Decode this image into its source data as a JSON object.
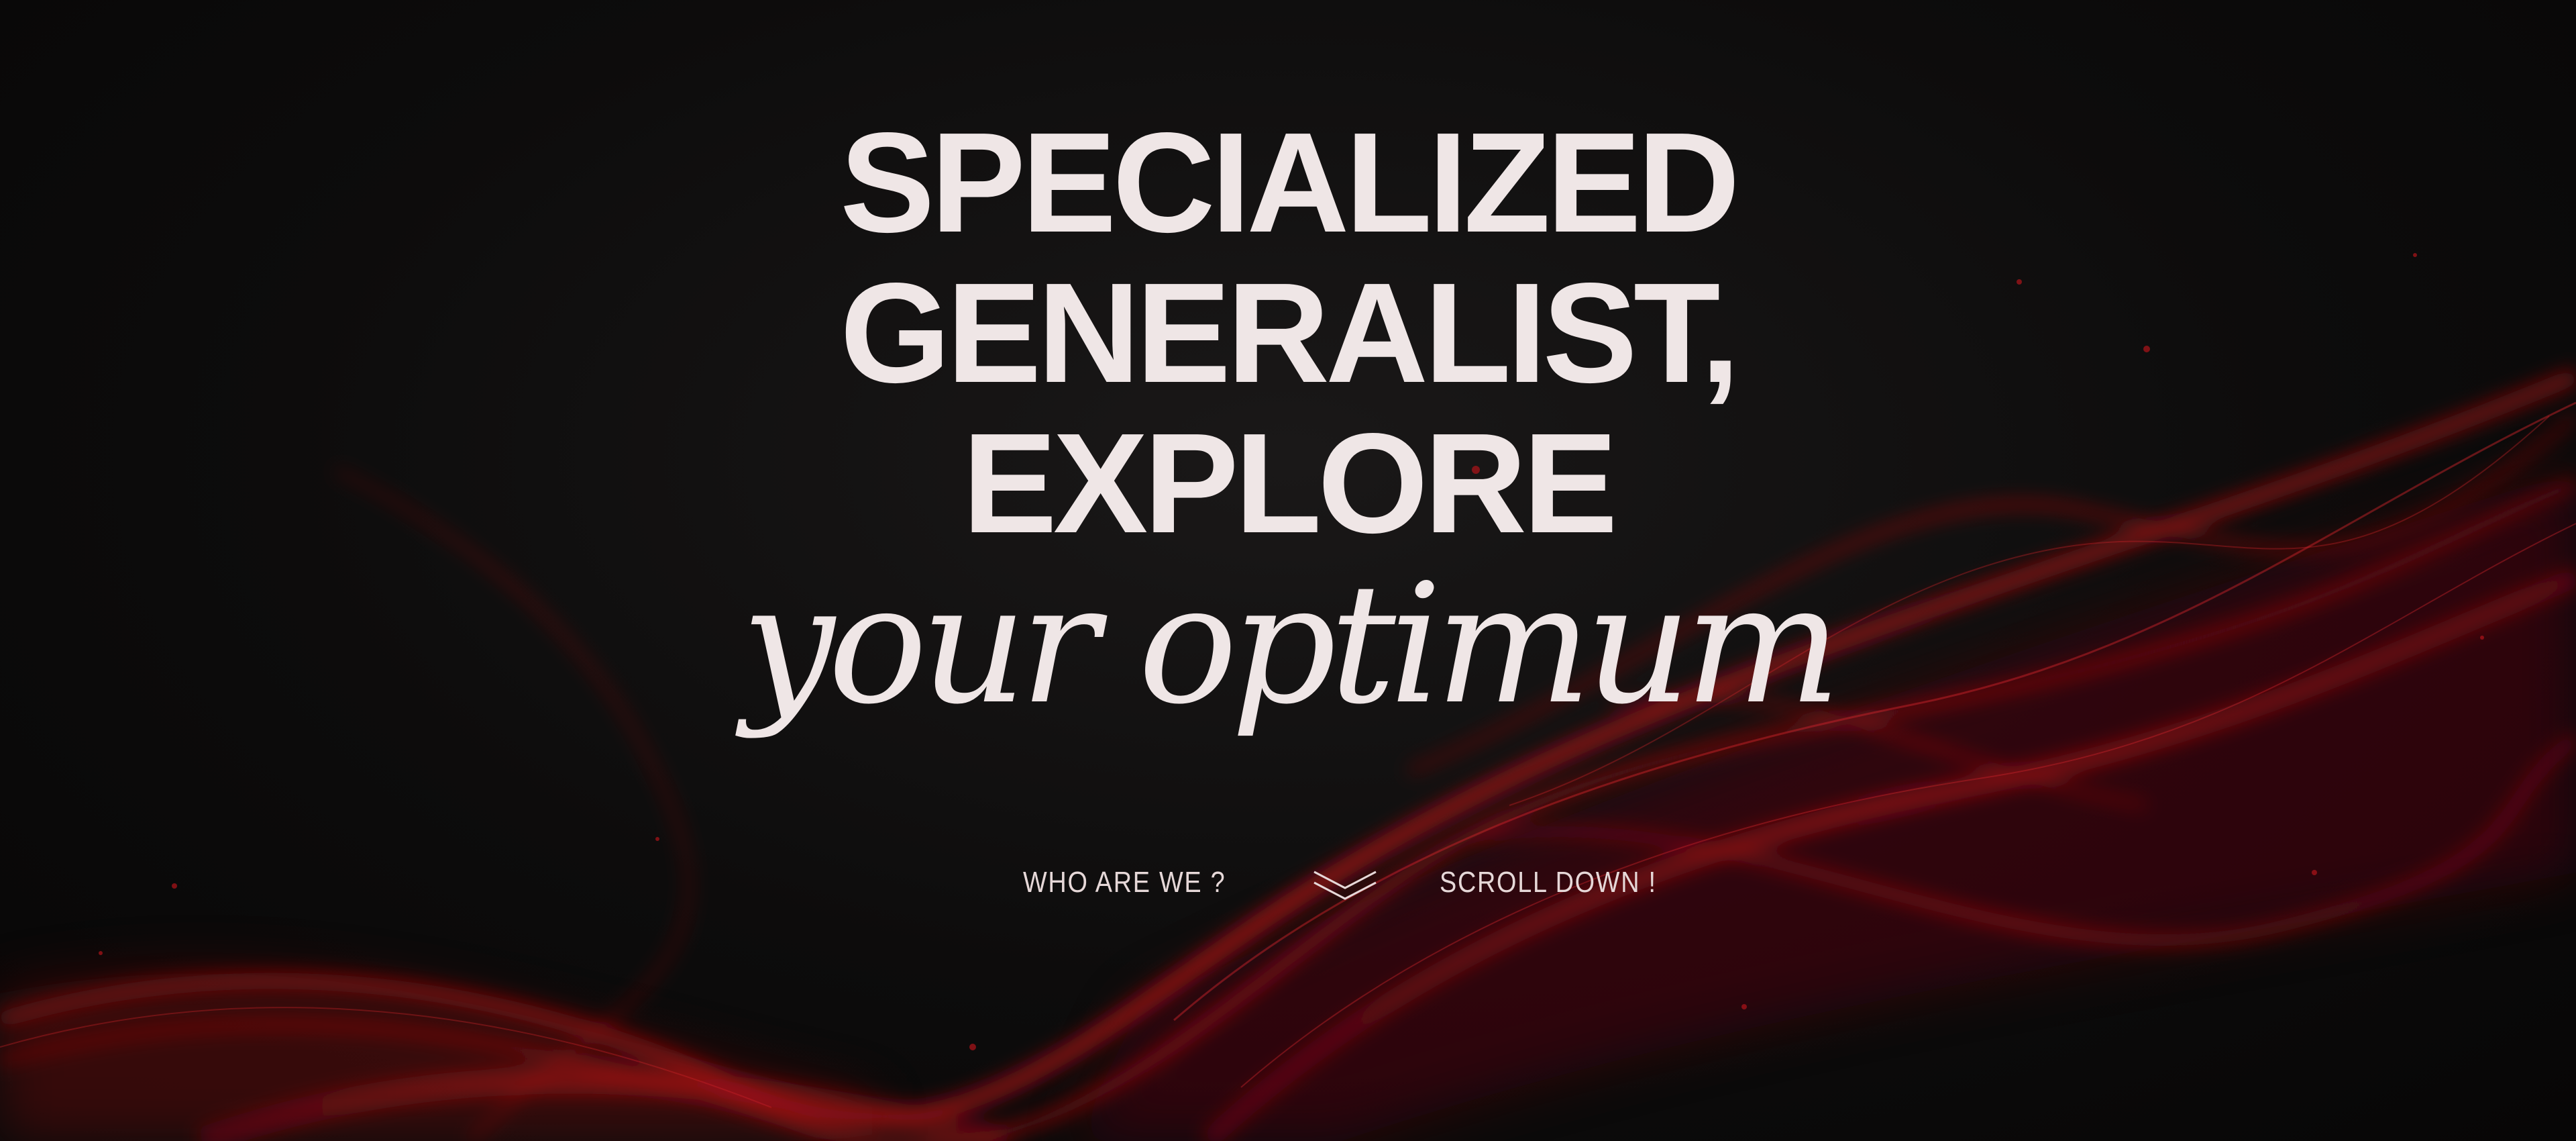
{
  "hero": {
    "line1": "SPECIALIZED",
    "line2": "GENERALIST,",
    "line3": "EXPLORE",
    "line4": "your optimum"
  },
  "nav": {
    "who_label": "WHO ARE WE ?",
    "scroll_label": "SCROLL DOWN !",
    "scroll_icon": "double-chevron-down-icon"
  },
  "colors": {
    "background": "#0c0b0b",
    "text": "#efe6e6",
    "smoke": "#b01217"
  }
}
